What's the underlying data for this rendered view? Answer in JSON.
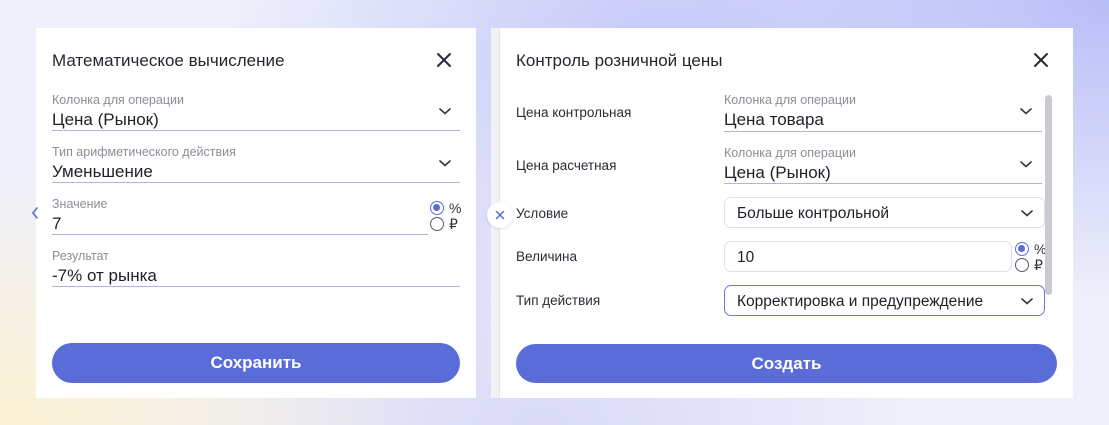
{
  "math_panel": {
    "title": "Математическое вычисление",
    "column_field": {
      "label": "Колонка для операции",
      "value": "Цена (Рынок)"
    },
    "operation_field": {
      "label": "Тип арифметического действия",
      "value": "Уменьшение"
    },
    "value_field": {
      "label": "Значение",
      "value": "7"
    },
    "unit_options": [
      {
        "label": "%",
        "selected": true
      },
      {
        "label": "₽",
        "selected": false
      }
    ],
    "result_field": {
      "label": "Результат",
      "value": "-7% от рынка"
    },
    "save_label": "Сохранить"
  },
  "price_panel": {
    "title": "Контроль розничной цены",
    "control_price": {
      "row_label": "Цена контрольная",
      "label": "Колонка для операции",
      "value": "Цена товара"
    },
    "calc_price": {
      "row_label": "Цена расчетная",
      "label": "Колонка для операции",
      "value": "Цена (Рынок)"
    },
    "condition": {
      "row_label": "Условие",
      "value": "Больше контрольной"
    },
    "amount": {
      "row_label": "Величина",
      "value": "10"
    },
    "unit_options": [
      {
        "label": "%",
        "selected": true
      },
      {
        "label": "₽",
        "selected": false
      }
    ],
    "action_type": {
      "row_label": "Тип действия",
      "value": "Корректировка и предупреждение"
    },
    "create_label": "Создать"
  },
  "icons": {
    "close": "close-icon",
    "chevron": "chevron-down-icon",
    "collapse": "chevron-left-icon"
  },
  "colors": {
    "accent": "#5a6cd8",
    "field_underline": "#aeb3e2",
    "label_gray": "#8b8e99"
  }
}
